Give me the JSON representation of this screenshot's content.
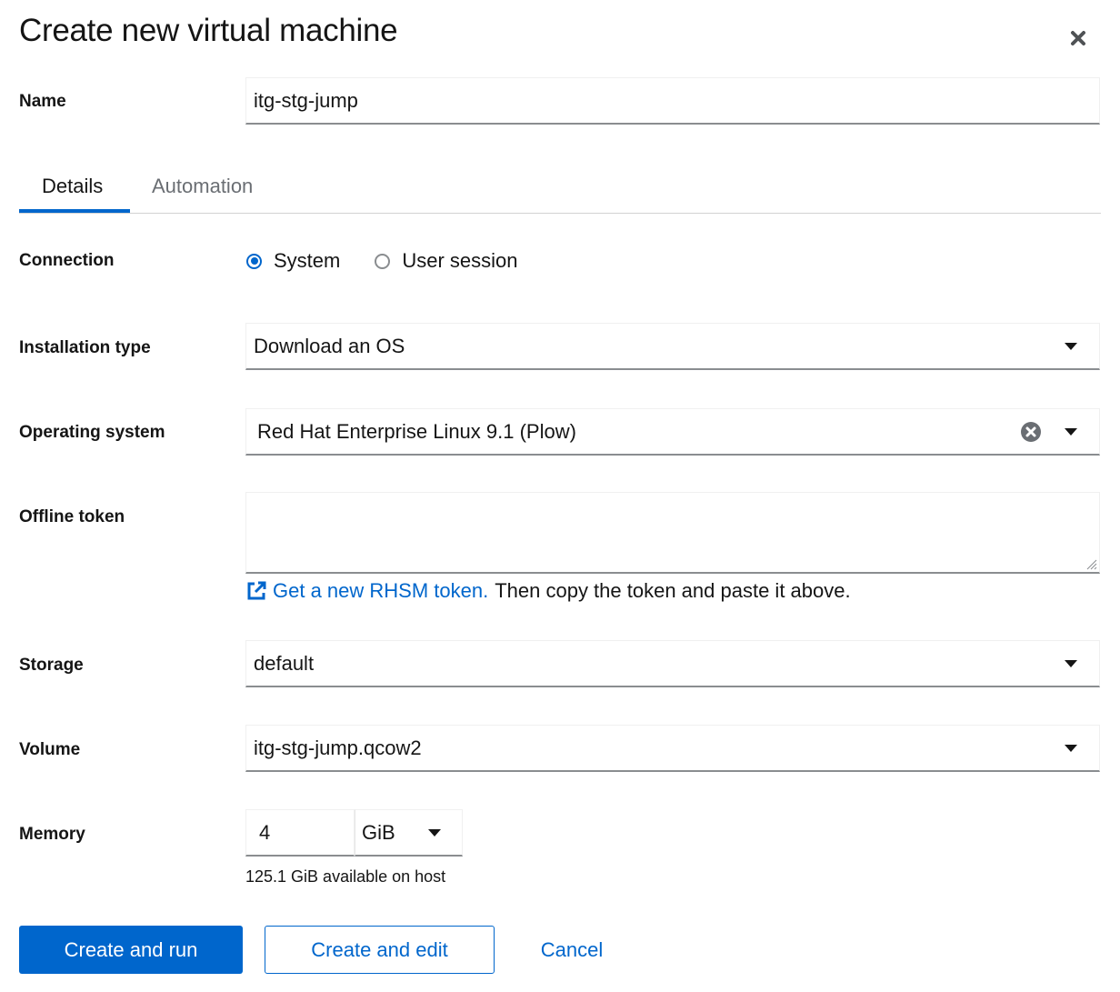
{
  "dialog": {
    "title": "Create new virtual machine",
    "close_icon": "close-icon"
  },
  "name": {
    "label": "Name",
    "value": "itg-stg-jump"
  },
  "tabs": [
    {
      "label": "Details",
      "active": true
    },
    {
      "label": "Automation",
      "active": false
    }
  ],
  "connection": {
    "label": "Connection",
    "options": [
      {
        "label": "System",
        "checked": true
      },
      {
        "label": "User session",
        "checked": false
      }
    ]
  },
  "installation_type": {
    "label": "Installation type",
    "value": "Download an OS"
  },
  "operating_system": {
    "label": "Operating system",
    "value": "Red Hat Enterprise Linux 9.1 (Plow)"
  },
  "offline_token": {
    "label": "Offline token",
    "value": "",
    "link_text": "Get a new RHSM token.",
    "helper_text": "Then copy the token and paste it above."
  },
  "storage": {
    "label": "Storage",
    "value": "default"
  },
  "volume": {
    "label": "Volume",
    "value": "itg-stg-jump.qcow2"
  },
  "memory": {
    "label": "Memory",
    "value": "4",
    "unit": "GiB",
    "helper": "125.1 GiB available on host"
  },
  "actions": {
    "create_and_run": "Create and run",
    "create_and_edit": "Create and edit",
    "cancel": "Cancel"
  },
  "colors": {
    "accent": "#0066cc",
    "text": "#151515",
    "muted": "#6a6e73"
  }
}
